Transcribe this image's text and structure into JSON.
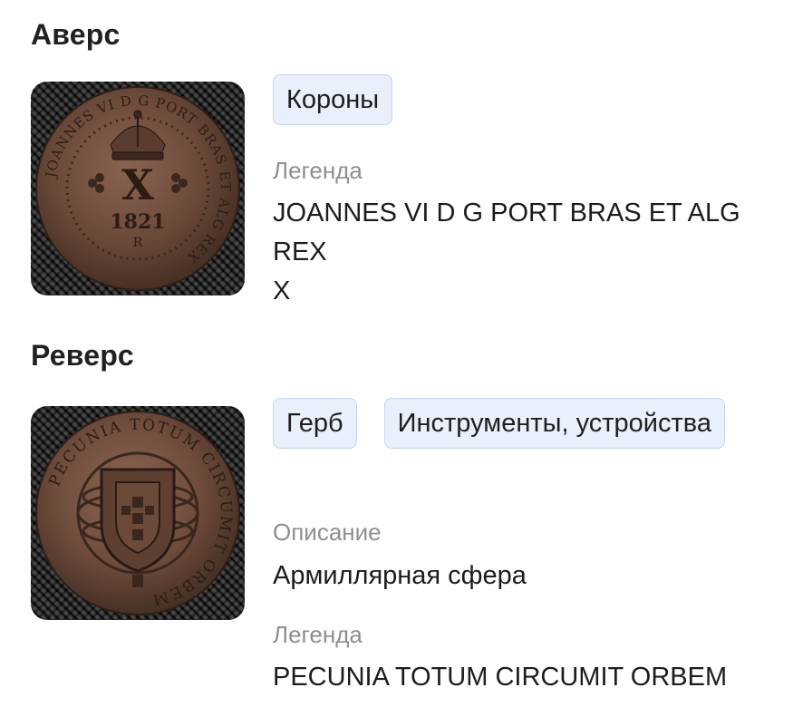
{
  "obverse": {
    "title": "Аверс",
    "chips": [
      "Короны"
    ],
    "legend_label": "Легенда",
    "legend_lines": [
      "JOANNES VI D G PORT BRAS ET ALG",
      "REX",
      "X"
    ],
    "coin_text": {
      "ring": "JOANNES VI D G PORT BRAS ET ALG REX",
      "denomination": "X",
      "year": "1821",
      "mint": "R"
    }
  },
  "reverse": {
    "title": "Реверс",
    "chips": [
      "Герб",
      "Инструменты, устройства"
    ],
    "description_label": "Описание",
    "description_value": "Армиллярная сфера",
    "legend_label": "Легенда",
    "legend_value": "PECUNIA TOTUM CIRCUMIT ORBEM",
    "coin_text": {
      "ring": "PECUNIA TOTUM CIRCUMIT ORBEM"
    }
  },
  "colors": {
    "chip_bg": "#e9effb",
    "chip_border": "#c6d4f0",
    "label_gray": "#8e8e93",
    "coin_copper": "#6b4a3a"
  }
}
